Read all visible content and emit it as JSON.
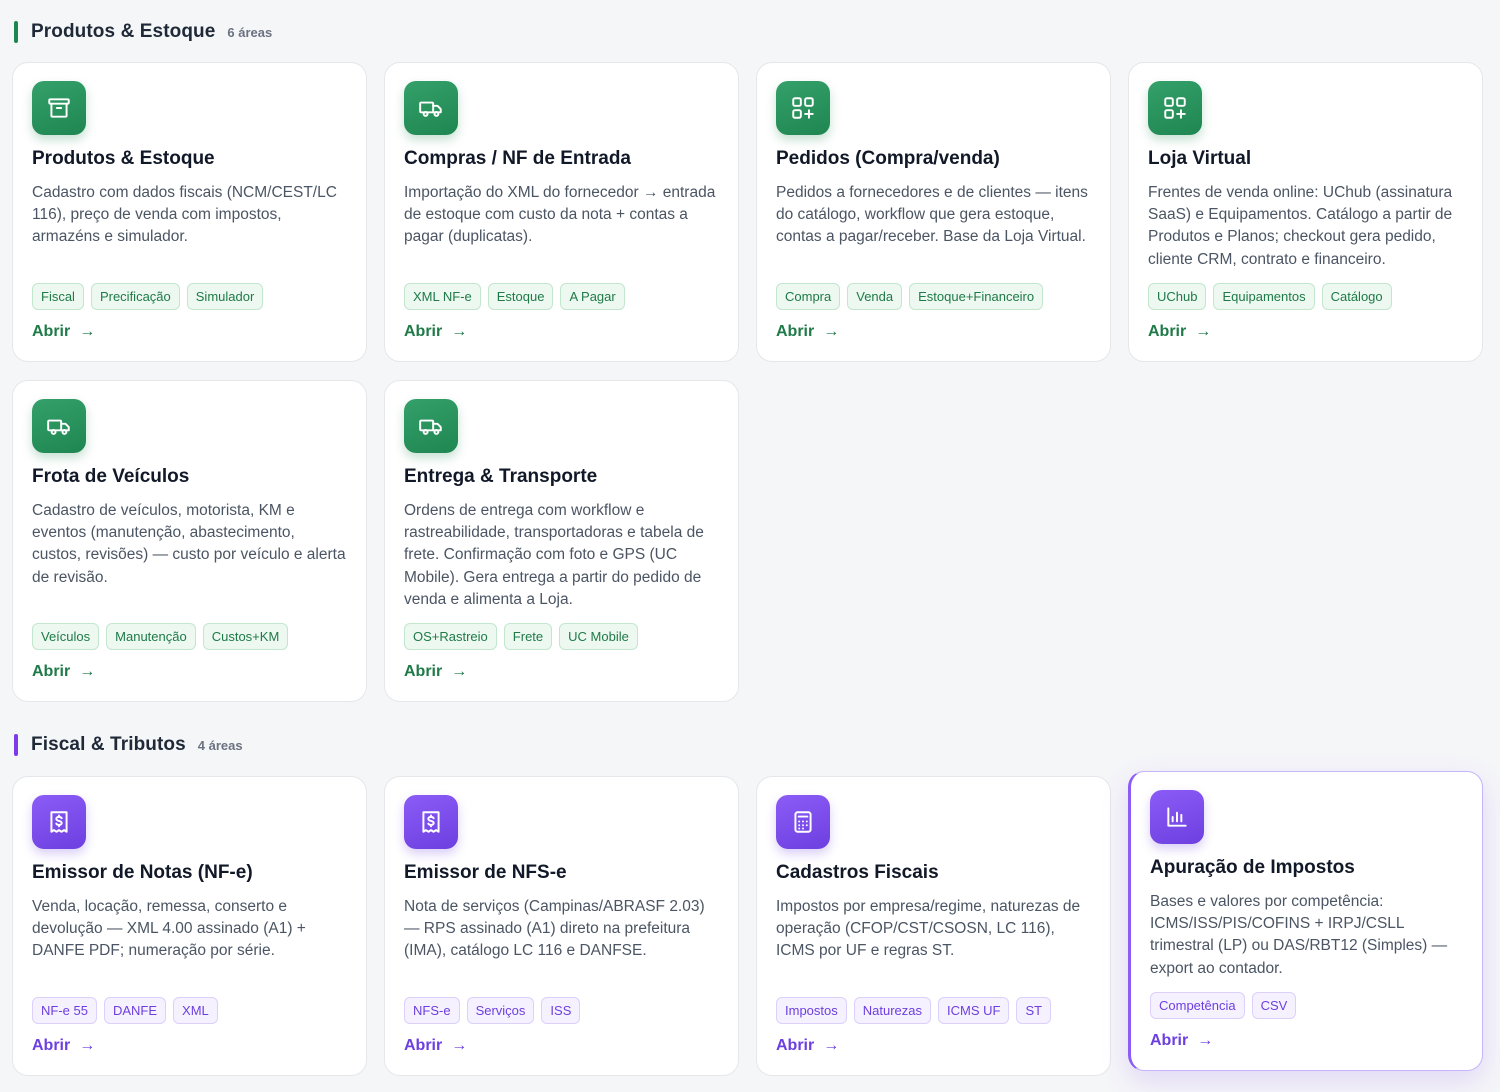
{
  "sections": [
    {
      "title": "Produtos & Estoque",
      "count": "6 áreas",
      "accent": "#1f8651",
      "cards": [
        {
          "icon": "archive-icon",
          "title": "Produtos & Estoque",
          "description": "Cadastro com dados fiscais (NCM/CEST/LC 116), preço de venda com impostos, armazéns e simulador.",
          "tags": [
            "Fiscal",
            "Precificação",
            "Simulador"
          ],
          "link": "Abrir",
          "arrow": "→"
        },
        {
          "icon": "truck-icon",
          "title": "Compras / NF de Entrada",
          "description": "Importação do XML do fornecedor → entrada de estoque com custo da nota + contas a pagar (duplicatas).",
          "tags": [
            "XML NF-e",
            "Estoque",
            "A Pagar"
          ],
          "link": "Abrir",
          "arrow": "→"
        },
        {
          "icon": "grid-plus-icon",
          "title": "Pedidos (Compra/venda)",
          "description": "Pedidos a fornecedores e de clientes — itens do catálogo, workflow que gera estoque, contas a pagar/receber. Base da Loja Virtual.",
          "tags": [
            "Compra",
            "Venda",
            "Estoque+Financeiro"
          ],
          "link": "Abrir",
          "arrow": "→"
        },
        {
          "icon": "grid-plus-icon",
          "title": "Loja Virtual",
          "description": "Frentes de venda online: UChub (assinatura SaaS) e Equipamentos. Catálogo a partir de Produtos e Planos; checkout gera pedido, cliente CRM, contrato e financeiro.",
          "tags": [
            "UChub",
            "Equipamentos",
            "Catálogo"
          ],
          "link": "Abrir",
          "arrow": "→"
        },
        {
          "icon": "truck-icon",
          "title": "Frota de Veículos",
          "description": "Cadastro de veículos, motorista, KM e eventos (manutenção, abastecimento, custos, revisões) — custo por veículo e alerta de revisão.",
          "tags": [
            "Veículos",
            "Manutenção",
            "Custos+KM"
          ],
          "link": "Abrir",
          "arrow": "→"
        },
        {
          "icon": "truck-icon",
          "title": "Entrega & Transporte",
          "description": "Ordens de entrega com workflow e rastreabilidade, transportadoras e tabela de frete. Confirmação com foto e GPS (UC Mobile). Gera entrega a partir do pedido de venda e alimenta a Loja.",
          "tags": [
            "OS+Rastreio",
            "Frete",
            "UC Mobile"
          ],
          "link": "Abrir",
          "arrow": "→"
        }
      ]
    },
    {
      "title": "Fiscal & Tributos",
      "count": "4 áreas",
      "accent": "#7c3aed",
      "cards": [
        {
          "icon": "receipt-dollar-icon",
          "title": "Emissor de Notas (NF-e)",
          "description": "Venda, locação, remessa, conserto e devolução — XML 4.00 assinado (A1) + DANFE PDF; numeração por série.",
          "tags": [
            "NF-e 55",
            "DANFE",
            "XML"
          ],
          "link": "Abrir",
          "arrow": "→"
        },
        {
          "icon": "receipt-dollar-icon",
          "title": "Emissor de NFS-e",
          "description": "Nota de serviços (Campinas/ABRASF 2.03) — RPS assinado (A1) direto na prefeitura (IMA), catálogo LC 116 e DANFSE.",
          "tags": [
            "NFS-e",
            "Serviços",
            "ISS"
          ],
          "link": "Abrir",
          "arrow": "→"
        },
        {
          "icon": "calculator-icon",
          "title": "Cadastros Fiscais",
          "description": "Impostos por empresa/regime, naturezas de operação (CFOP/CST/CSOSN, LC 116), ICMS por UF e regras ST.",
          "tags": [
            "Impostos",
            "Naturezas",
            "ICMS UF",
            "ST"
          ],
          "link": "Abrir",
          "arrow": "→"
        },
        {
          "icon": "bar-chart-icon",
          "title": "Apuração de Impostos",
          "description": "Bases e valores por competência: ICMS/ISS/PIS/COFINS + IRPJ/CSLL trimestral (LP) ou DAS/RBT12 (Simples) — export ao contador.",
          "tags": [
            "Competência",
            "CSV"
          ],
          "link": "Abrir",
          "arrow": "→"
        }
      ]
    }
  ]
}
